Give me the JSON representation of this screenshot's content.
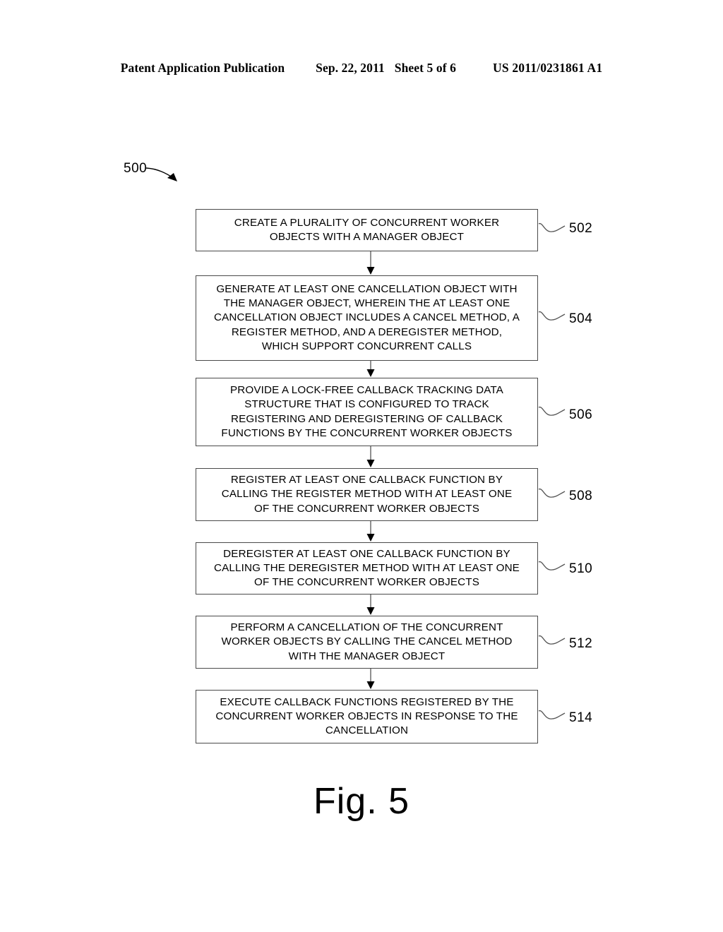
{
  "header": {
    "publication": "Patent Application Publication",
    "date": "Sep. 22, 2011",
    "sheet": "Sheet 5 of 6",
    "patent_number": "US 2011/0231861 A1"
  },
  "figure": {
    "caption": "Fig. 5",
    "diagram_reference": "500",
    "steps": [
      {
        "ref": "502",
        "text": "CREATE A PLURALITY OF CONCURRENT WORKER\nOBJECTS WITH A MANAGER OBJECT"
      },
      {
        "ref": "504",
        "text": "GENERATE AT LEAST ONE CANCELLATION OBJECT WITH\nTHE MANAGER OBJECT, WHEREIN THE AT LEAST ONE\nCANCELLATION OBJECT INCLUDES A CANCEL METHOD, A\nREGISTER METHOD, AND A DEREGISTER METHOD,\nWHICH SUPPORT CONCURRENT CALLS"
      },
      {
        "ref": "506",
        "text": "PROVIDE A LOCK-FREE CALLBACK TRACKING DATA\nSTRUCTURE THAT IS CONFIGURED TO TRACK\nREGISTERING AND DEREGISTERING OF CALLBACK\nFUNCTIONS BY THE CONCURRENT WORKER OBJECTS"
      },
      {
        "ref": "508",
        "text": "REGISTER AT LEAST ONE CALLBACK FUNCTION BY\nCALLING THE REGISTER METHOD WITH AT LEAST ONE\nOF THE CONCURRENT WORKER OBJECTS"
      },
      {
        "ref": "510",
        "text": "DEREGISTER AT LEAST ONE CALLBACK FUNCTION BY\nCALLING THE DEREGISTER METHOD WITH AT LEAST ONE\nOF THE CONCURRENT WORKER OBJECTS"
      },
      {
        "ref": "512",
        "text": "PERFORM A CANCELLATION OF THE CONCURRENT\nWORKER OBJECTS BY CALLING THE CANCEL METHOD\nWITH THE MANAGER OBJECT"
      },
      {
        "ref": "514",
        "text": "EXECUTE CALLBACK FUNCTIONS REGISTERED BY THE\nCONCURRENT WORKER OBJECTS IN RESPONSE TO THE\nCANCELLATION"
      }
    ]
  },
  "colors": {
    "ink": "#000000",
    "box_border": "#4a4a4a",
    "page_background": "#ffffff"
  }
}
